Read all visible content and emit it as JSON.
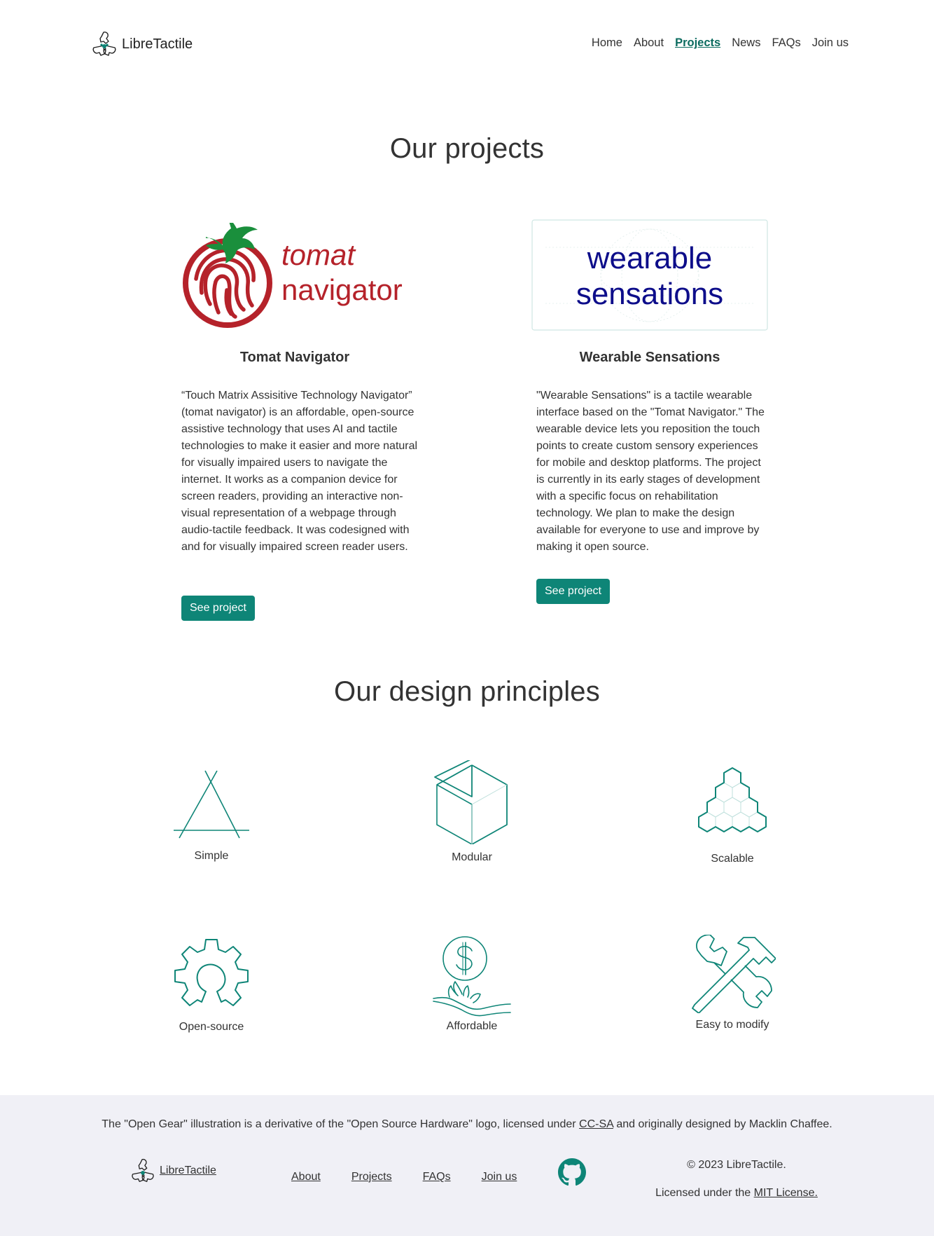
{
  "nav": {
    "brand": "LibreTactile",
    "items": [
      {
        "label": "Home",
        "active": false
      },
      {
        "label": "About",
        "active": false
      },
      {
        "label": "Projects",
        "active": true
      },
      {
        "label": "News",
        "active": false
      },
      {
        "label": "FAQs",
        "active": false
      },
      {
        "label": "Join us",
        "active": false
      }
    ]
  },
  "projects_section": {
    "title": "Our projects",
    "projects": [
      {
        "logo_line1": "tomat",
        "logo_line2": "navigator",
        "title": "Tomat Navigator",
        "description": "“Touch Matrix Assisitive Technology Navigator” (tomat navigator) is an affordable, open-source assistive technology that uses AI and tactile technologies to make it easier and more natural for visually impaired users to navigate the internet. It works as a companion device for screen readers, providing an interactive non-visual representation of a webpage through audio-tactile feedback. It was codesigned with and for visually impaired screen reader users.",
        "button": "See project",
        "logo_color": "#b5222a",
        "leaf_color": "#1a8f3c"
      },
      {
        "logo_line1": "wearable",
        "logo_line2": "sensations",
        "title": "Wearable Sensations",
        "description": "\"Wearable Sensations\" is a tactile wearable interface based on the \"Tomat Navigator.\" The wearable device lets you reposition the touch points to create custom sensory experiences for mobile and desktop platforms. The project is currently in its early stages of development with a specific focus on rehabilitation technology. We plan to make the design available for everyone to use and improve by making it open source.",
        "button": "See project",
        "logo_color": "#0d0d8a"
      }
    ]
  },
  "principles_section": {
    "title": "Our design principles",
    "items": [
      {
        "label": "Simple",
        "icon": "triangle-icon"
      },
      {
        "label": "Modular",
        "icon": "cube-icon"
      },
      {
        "label": "Scalable",
        "icon": "honeycomb-pyramid-icon"
      },
      {
        "label": "Open-source",
        "icon": "open-gear-icon"
      },
      {
        "label": "Affordable",
        "icon": "dollar-hand-icon"
      },
      {
        "label": "Easy to modify",
        "icon": "tools-icon"
      }
    ],
    "icon_color": "#0e8577"
  },
  "footer": {
    "note_before": "The \"Open Gear\" illustration is a derivative of the \"Open Source Hardware\" logo, licensed under ",
    "note_link": "CC-SA",
    "note_after": " and originally designed by Macklin Chaffee.",
    "brand": "LibreTactile",
    "links": [
      "About",
      "Projects",
      "FAQs",
      "Join us"
    ],
    "copyright": "© 2023 LibreTactile.",
    "license_before": "Licensed under the ",
    "license_link": "MIT License.",
    "background": "#f0f0f6"
  },
  "accent_color": "#0e8577"
}
